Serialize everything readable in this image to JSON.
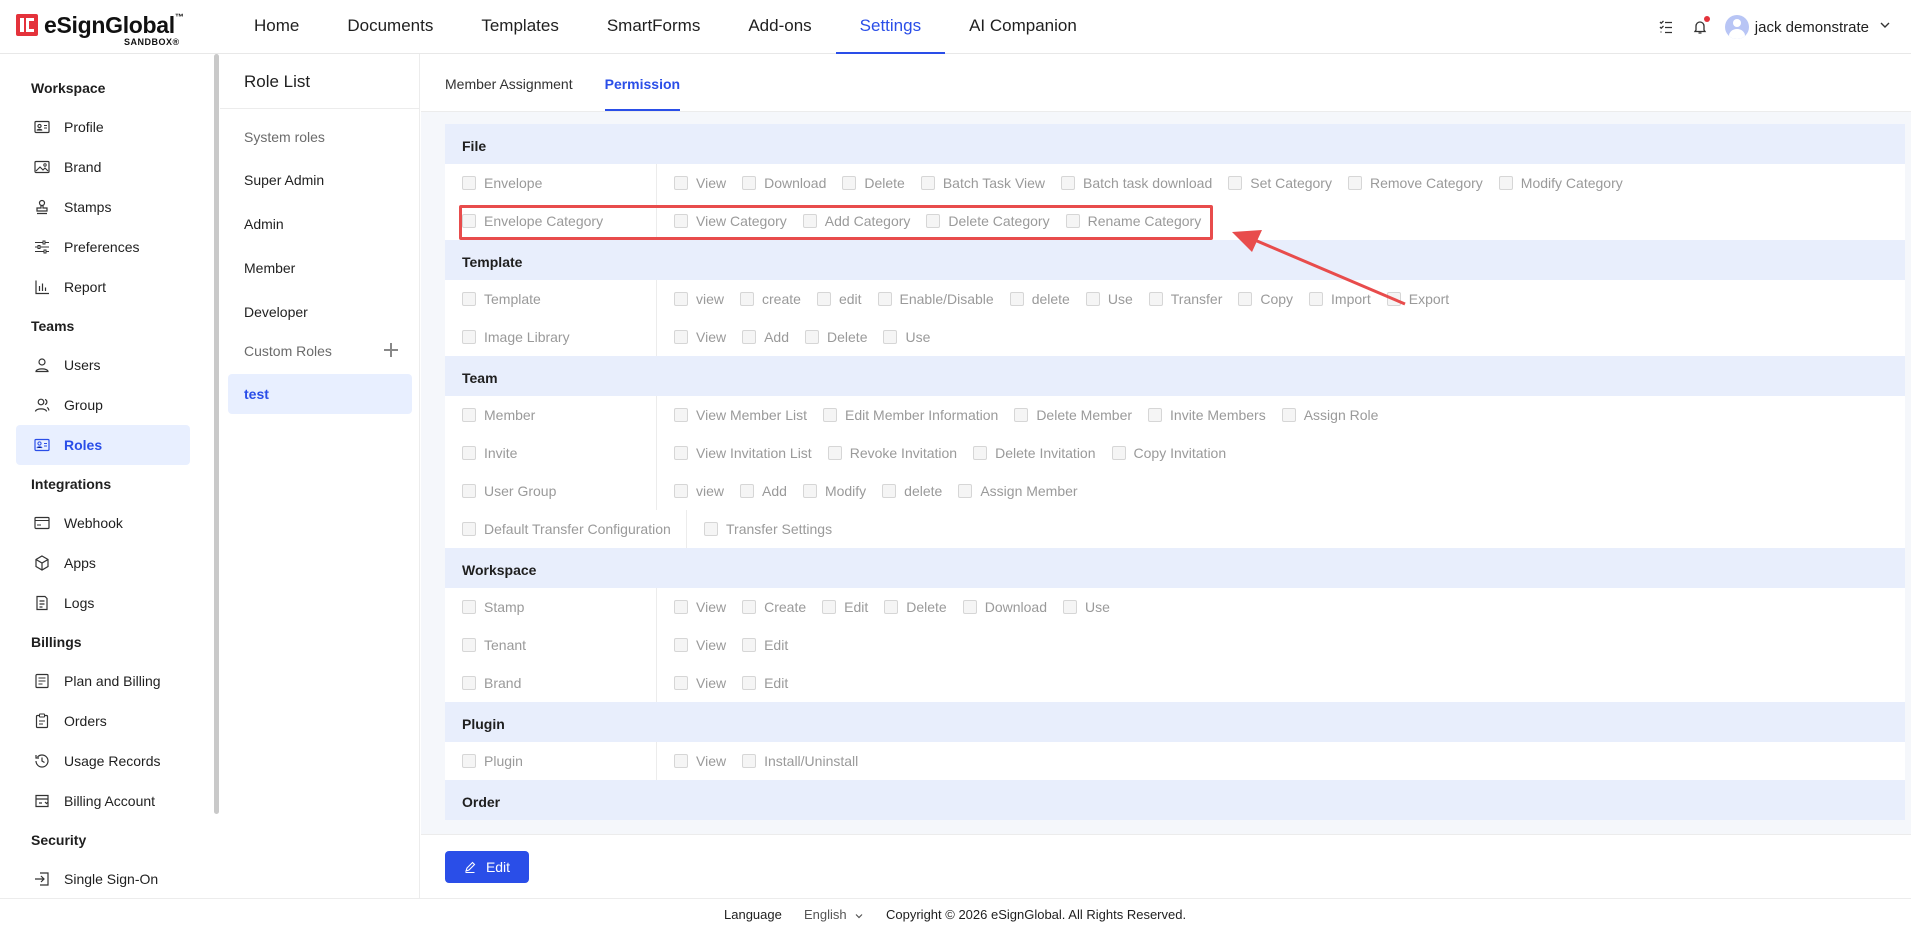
{
  "brand": {
    "name": "eSignGlobal",
    "tm": "™",
    "sub": "SANDBOX®"
  },
  "nav": {
    "items": [
      {
        "label": "Home",
        "active": false
      },
      {
        "label": "Documents",
        "active": false
      },
      {
        "label": "Templates",
        "active": false
      },
      {
        "label": "SmartForms",
        "active": false
      },
      {
        "label": "Add-ons",
        "active": false
      },
      {
        "label": "Settings",
        "active": true
      },
      {
        "label": "AI Companion",
        "active": false
      }
    ]
  },
  "user": {
    "name": "jack demonstrate"
  },
  "sidebar": {
    "groups": {
      "workspace": "Workspace",
      "teams": "Teams",
      "integrations": "Integrations",
      "billings": "Billings",
      "security": "Security"
    },
    "items": {
      "profile": "Profile",
      "brand": "Brand",
      "stamps": "Stamps",
      "preferences": "Preferences",
      "report": "Report",
      "users": "Users",
      "group": "Group",
      "roles": "Roles",
      "webhook": "Webhook",
      "apps": "Apps",
      "logs": "Logs",
      "plan_billing": "Plan and Billing",
      "orders": "Orders",
      "usage_records": "Usage Records",
      "billing_account": "Billing Account",
      "sso": "Single Sign-On"
    }
  },
  "role_list": {
    "title": "Role List",
    "system_roles": "System roles",
    "super_admin": "Super Admin",
    "admin": "Admin",
    "member": "Member",
    "developer": "Developer",
    "custom_roles": "Custom Roles",
    "test": "test"
  },
  "tabs": {
    "member_assignment": "Member Assignment",
    "permission": "Permission"
  },
  "permissions": [
    {
      "section": "File",
      "rows": [
        {
          "label": "Envelope",
          "options": [
            "View",
            "Download",
            "Delete",
            "Batch Task View",
            "Batch task download",
            "Set Category",
            "Remove Category",
            "Modify Category"
          ]
        },
        {
          "label": "Envelope Category",
          "options": [
            "View Category",
            "Add Category",
            "Delete Category",
            "Rename Category"
          ]
        }
      ]
    },
    {
      "section": "Template",
      "rows": [
        {
          "label": "Template",
          "options": [
            "view",
            "create",
            "edit",
            "Enable/Disable",
            "delete",
            "Use",
            "Transfer",
            "Copy",
            "Import",
            "Export"
          ]
        },
        {
          "label": "Image Library",
          "options": [
            "View",
            "Add",
            "Delete",
            "Use"
          ]
        }
      ]
    },
    {
      "section": "Team",
      "rows": [
        {
          "label": "Member",
          "options": [
            "View Member List",
            "Edit Member Information",
            "Delete Member",
            "Invite Members",
            "Assign Role"
          ]
        },
        {
          "label": "Invite",
          "options": [
            "View Invitation List",
            "Revoke Invitation",
            "Delete Invitation",
            "Copy Invitation"
          ]
        },
        {
          "label": "User Group",
          "options": [
            "view",
            "Add",
            "Modify",
            "delete",
            "Assign Member"
          ]
        },
        {
          "label": "Default Transfer Configuration",
          "wide": true,
          "options": [
            "Transfer Settings"
          ]
        }
      ]
    },
    {
      "section": "Workspace",
      "rows": [
        {
          "label": "Stamp",
          "options": [
            "View",
            "Create",
            "Edit",
            "Delete",
            "Download",
            "Use"
          ]
        },
        {
          "label": "Tenant",
          "options": [
            "View",
            "Edit"
          ]
        },
        {
          "label": "Brand",
          "options": [
            "View",
            "Edit"
          ]
        }
      ]
    },
    {
      "section": "Plugin",
      "rows": [
        {
          "label": "Plugin",
          "options": [
            "View",
            "Install/Uninstall"
          ]
        }
      ]
    },
    {
      "section": "Order",
      "rows": []
    }
  ],
  "actions": {
    "edit": "Edit"
  },
  "footer": {
    "language_label": "Language",
    "language_value": "English",
    "copyright": "Copyright © 2026 eSignGlobal. All Rights Reserved."
  },
  "colors": {
    "accent": "#2a4ee8",
    "highlight": "#e84c4c",
    "brand_red": "#e4323b"
  }
}
